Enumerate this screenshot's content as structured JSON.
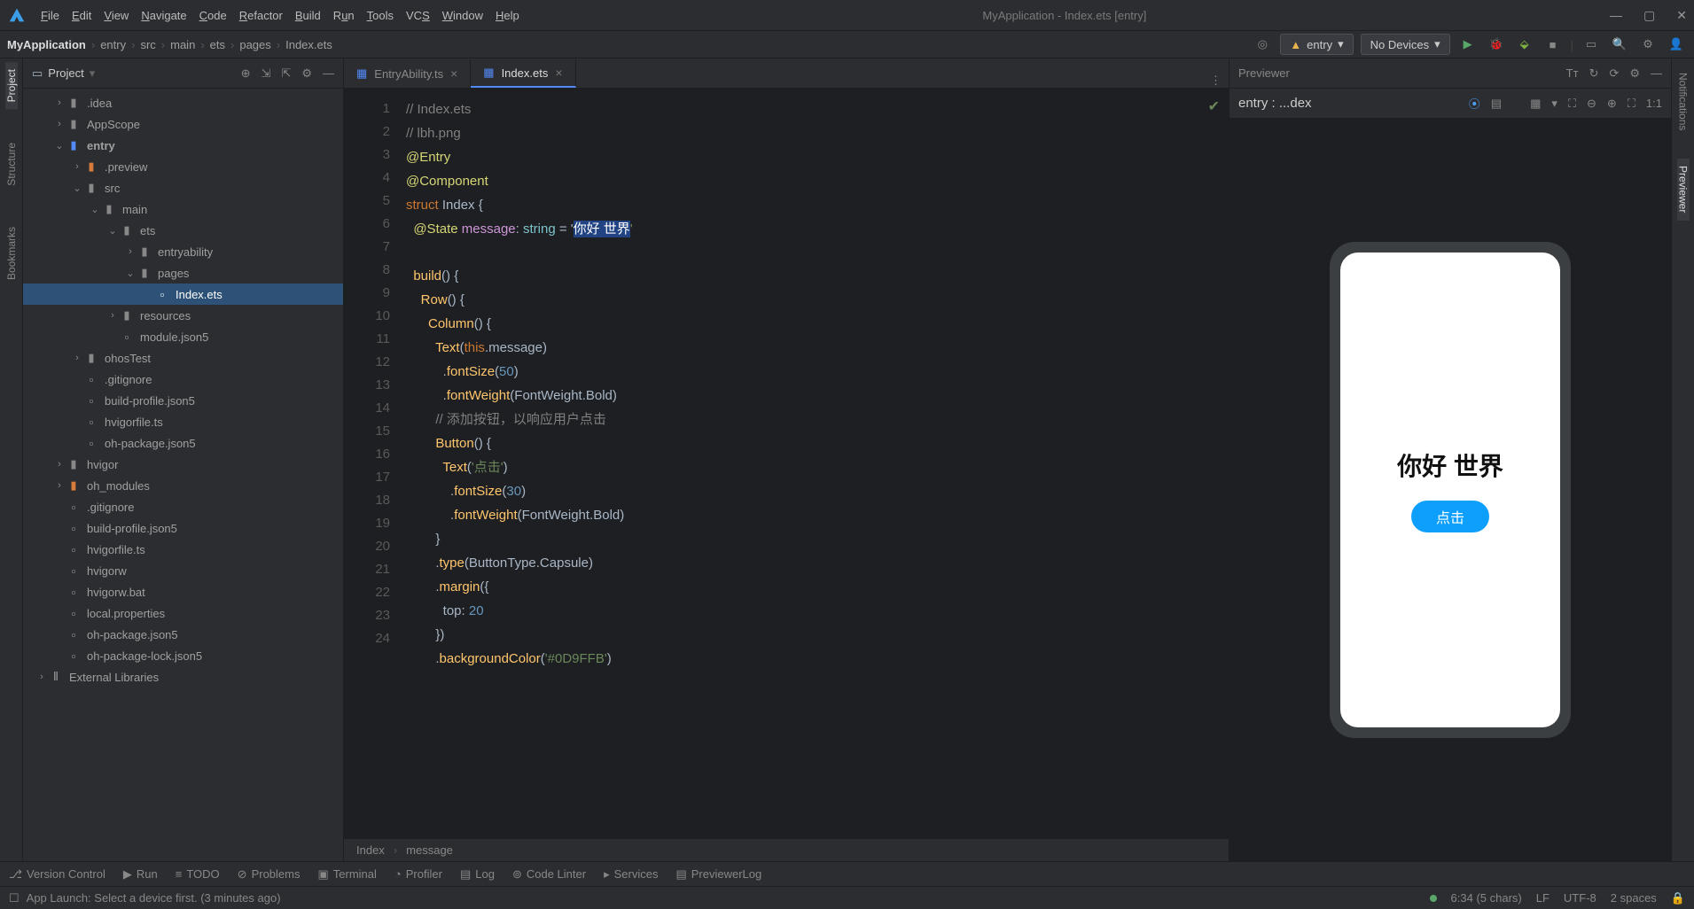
{
  "window": {
    "title": "MyApplication - Index.ets [entry]"
  },
  "menu": [
    "File",
    "Edit",
    "View",
    "Navigate",
    "Code",
    "Refactor",
    "Build",
    "Run",
    "Tools",
    "VCS",
    "Window",
    "Help"
  ],
  "breadcrumb": [
    "MyApplication",
    "entry",
    "src",
    "main",
    "ets",
    "pages",
    "Index.ets"
  ],
  "runconfig": {
    "module": "entry",
    "device": "No Devices"
  },
  "project": {
    "title": "Project",
    "tree": [
      {
        "d": 34,
        "a": ">",
        "i": "fo-closed",
        "t": ".idea"
      },
      {
        "d": 34,
        "a": ">",
        "i": "fo-closed",
        "t": "AppScope"
      },
      {
        "d": 34,
        "a": "v",
        "i": "fo-src",
        "t": "entry",
        "bold": true
      },
      {
        "d": 54,
        "a": ">",
        "i": "fo-open",
        "t": ".preview"
      },
      {
        "d": 54,
        "a": "v",
        "i": "fo-closed",
        "t": "src"
      },
      {
        "d": 74,
        "a": "v",
        "i": "fo-closed",
        "t": "main"
      },
      {
        "d": 94,
        "a": "v",
        "i": "fo-closed",
        "t": "ets"
      },
      {
        "d": 114,
        "a": ">",
        "i": "fo-closed",
        "t": "entryability"
      },
      {
        "d": 114,
        "a": "v",
        "i": "fo-closed",
        "t": "pages"
      },
      {
        "d": 134,
        "a": "",
        "i": "file",
        "t": "Index.ets",
        "sel": true
      },
      {
        "d": 94,
        "a": ">",
        "i": "fo-closed",
        "t": "resources"
      },
      {
        "d": 94,
        "a": "",
        "i": "file",
        "t": "module.json5"
      },
      {
        "d": 54,
        "a": ">",
        "i": "fo-closed",
        "t": "ohosTest"
      },
      {
        "d": 54,
        "a": "",
        "i": "file",
        "t": ".gitignore"
      },
      {
        "d": 54,
        "a": "",
        "i": "file",
        "t": "build-profile.json5"
      },
      {
        "d": 54,
        "a": "",
        "i": "file",
        "t": "hvigorfile.ts"
      },
      {
        "d": 54,
        "a": "",
        "i": "file",
        "t": "oh-package.json5"
      },
      {
        "d": 34,
        "a": ">",
        "i": "fo-closed",
        "t": "hvigor"
      },
      {
        "d": 34,
        "a": ">",
        "i": "fo-open",
        "t": "oh_modules"
      },
      {
        "d": 34,
        "a": "",
        "i": "file",
        "t": ".gitignore"
      },
      {
        "d": 34,
        "a": "",
        "i": "file",
        "t": "build-profile.json5"
      },
      {
        "d": 34,
        "a": "",
        "i": "file",
        "t": "hvigorfile.ts"
      },
      {
        "d": 34,
        "a": "",
        "i": "file",
        "t": "hvigorw"
      },
      {
        "d": 34,
        "a": "",
        "i": "file",
        "t": "hvigorw.bat"
      },
      {
        "d": 34,
        "a": "",
        "i": "file",
        "t": "local.properties"
      },
      {
        "d": 34,
        "a": "",
        "i": "file",
        "t": "oh-package.json5"
      },
      {
        "d": 34,
        "a": "",
        "i": "file",
        "t": "oh-package-lock.json5"
      },
      {
        "d": 14,
        "a": ">",
        "i": "lib",
        "t": "External Libraries"
      }
    ]
  },
  "tabs": [
    {
      "label": "EntryAbility.ts",
      "active": false
    },
    {
      "label": "Index.ets",
      "active": true
    }
  ],
  "code": {
    "lines": [
      "1",
      "2",
      "3",
      "4",
      "5",
      "6",
      "7",
      "8",
      "9",
      "10",
      "11",
      "12",
      "13",
      "14",
      "15",
      "16",
      "17",
      "18",
      "19",
      "20",
      "21",
      "22",
      "23",
      "24"
    ],
    "crumb1": "Index",
    "crumb2": "message",
    "l1": "// Index.ets",
    "l2": "// lbh.png",
    "l3": "@Entry",
    "l4": "@Component",
    "l5a": "struct",
    "l5b": " Index {",
    "l6a": "  @State",
    "l6b": " message",
    "l6c": ": ",
    "l6d": "string",
    "l6e": " = '",
    "l6f": "你好 世界",
    "l6g": "'",
    "l8a": "  build",
    "l8b": "() {",
    "l9a": "    Row",
    "l9b": "() {",
    "l10a": "      Column",
    "l10b": "() {",
    "l11a": "        Text",
    "l11b": "(",
    "l11c": "this",
    "l11d": ".message)",
    "l12a": "          .",
    "l12b": "fontSize",
    "l12c": "(",
    "l12d": "50",
    "l12e": ")",
    "l13a": "          .",
    "l13b": "fontWeight",
    "l13c": "(FontWeight.Bold)",
    "l14": "        // 添加按钮，以响应用户点击",
    "l15a": "        Button",
    "l15b": "() {",
    "l16a": "          Text",
    "l16b": "(",
    "l16c": "'点击'",
    "l16d": ")",
    "l17a": "            .",
    "l17b": "fontSize",
    "l17c": "(",
    "l17d": "30",
    "l17e": ")",
    "l18a": "            .",
    "l18b": "fontWeight",
    "l18c": "(FontWeight.Bold)",
    "l19": "        }",
    "l20a": "        .",
    "l20b": "type",
    "l20c": "(ButtonType.Capsule)",
    "l21a": "        .",
    "l21b": "margin",
    "l21c": "({",
    "l22a": "          top: ",
    "l22b": "20",
    "l23": "        })",
    "l24a": "        .",
    "l24b": "backgroundColor",
    "l24c": "(",
    "l24d": "'#0D9FFB'",
    "l24e": ")"
  },
  "preview": {
    "title": "Previewer",
    "entry": "entry : ...dex",
    "message": "你好 世界",
    "button": "点击",
    "ratio": "1:1"
  },
  "leftTabs": [
    "Project",
    "Structure",
    "Bookmarks"
  ],
  "rightTabs": [
    "Notifications",
    "Previewer"
  ],
  "bottom": [
    "Version Control",
    "Run",
    "TODO",
    "Problems",
    "Terminal",
    "Profiler",
    "Log",
    "Code Linter",
    "Services",
    "PreviewerLog"
  ],
  "status": {
    "msg": "App Launch: Select a device first. (3 minutes ago)",
    "pos": "6:34 (5 chars)",
    "le": "LF",
    "enc": "UTF-8",
    "indent": "2 spaces"
  }
}
